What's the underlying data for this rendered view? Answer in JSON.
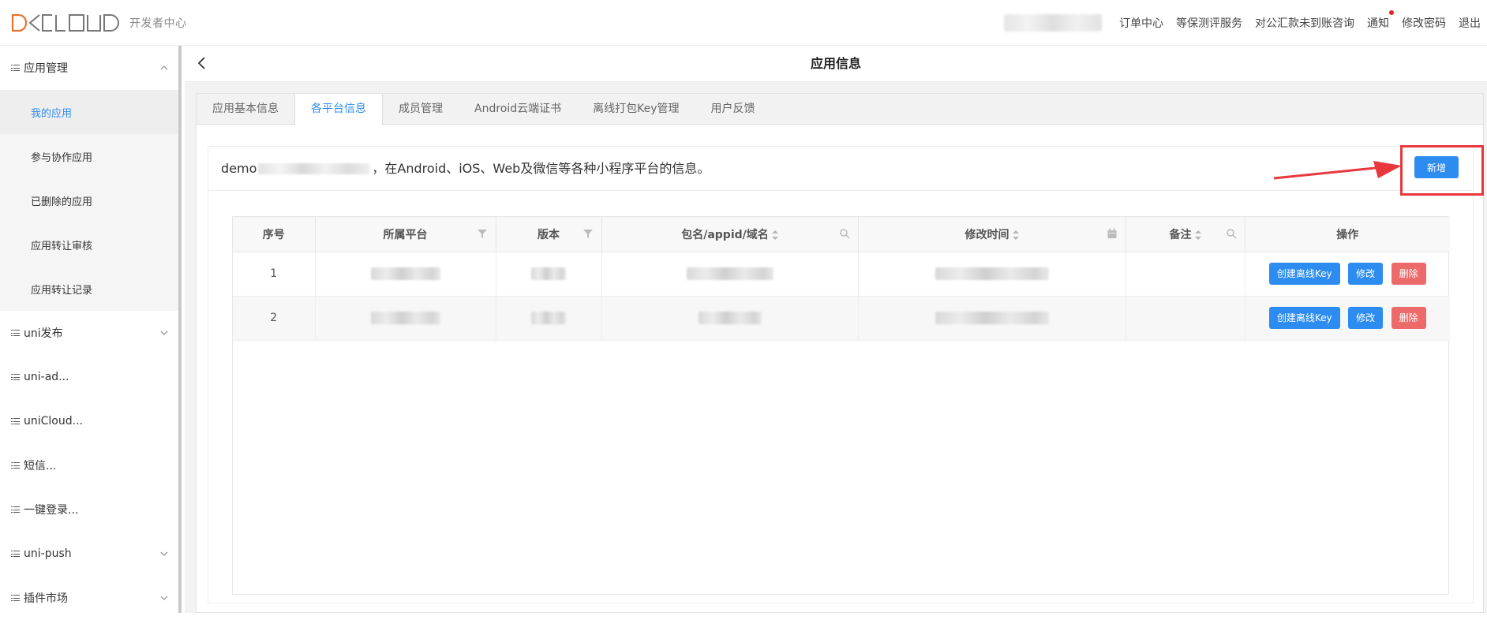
{
  "header": {
    "logo_sub": "开发者中心",
    "nav": [
      "订单中心",
      "等保测评服务",
      "对公汇款未到账咨询",
      "通知",
      "修改密码",
      "退出"
    ]
  },
  "sidebar": {
    "groups": [
      {
        "label": "应用管理",
        "children": [
          "我的应用",
          "参与协作应用",
          "已删除的应用",
          "应用转让审核",
          "应用转让记录"
        ]
      },
      {
        "label": "uni发布"
      },
      {
        "label": "uni-ad..."
      },
      {
        "label": "uniCloud..."
      },
      {
        "label": "短信..."
      },
      {
        "label": "一键登录..."
      },
      {
        "label": "uni-push"
      },
      {
        "label": "插件市场"
      }
    ]
  },
  "page": {
    "title": "应用信息",
    "tabs": [
      "应用基本信息",
      "各平台信息",
      "成员管理",
      "Android云端证书",
      "离线打包Key管理",
      "用户反馈"
    ],
    "desc_prefix": "demo",
    "desc_suffix": "，在Android、iOS、Web及微信等各种小程序平台的信息。",
    "add_button": "新增"
  },
  "table": {
    "columns": [
      "序号",
      "所属平台",
      "版本",
      "包名/appid/域名",
      "修改时间",
      "备注",
      "操作"
    ],
    "rows": [
      {
        "index": "1"
      },
      {
        "index": "2"
      }
    ],
    "actions": {
      "create_key": "创建离线Key",
      "edit": "修改",
      "delete": "删除"
    }
  },
  "colors": {
    "primary": "#2d8cf0",
    "danger": "#ed6a6a",
    "highlight": "#e8383d",
    "logo": "#e8732e"
  }
}
